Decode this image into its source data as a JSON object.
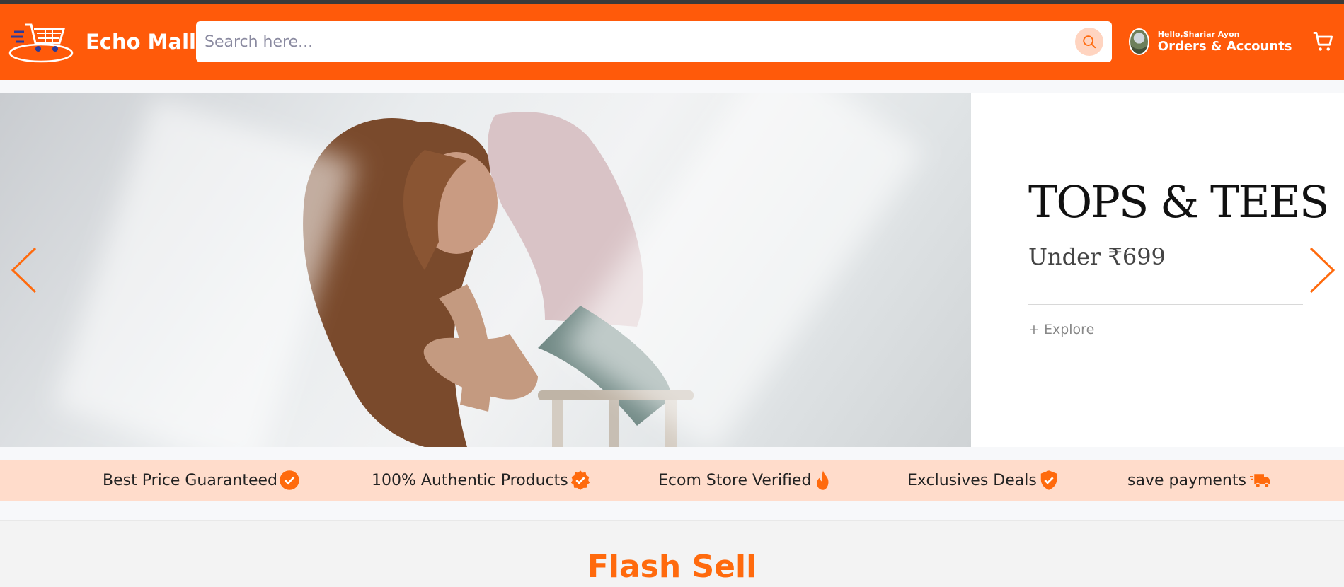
{
  "header": {
    "brand": "Echo Mall",
    "search_placeholder": "Search here...",
    "greeting": "Hello,Shariar Ayon",
    "account_label": "Orders & Accounts"
  },
  "hero": {
    "title": "TOPS & TEES",
    "subtitle": "Under ₹699",
    "link": "+ Explore"
  },
  "features": [
    {
      "label": "Best Price Guaranteed",
      "icon": "check-circle-icon"
    },
    {
      "label": "100% Authentic Products",
      "icon": "verified-badge-icon"
    },
    {
      "label": "Ecom Store Verified",
      "icon": "fire-icon"
    },
    {
      "label": "Exclusives Deals",
      "icon": "shield-check-icon"
    },
    {
      "label": "save payments",
      "icon": "delivery-truck-icon"
    }
  ],
  "section": {
    "title": "Flash Sell"
  },
  "colors": {
    "brand": "#ff5a0a",
    "feature_bar": "#ffdccb",
    "section_title": "#ff6a0d"
  }
}
